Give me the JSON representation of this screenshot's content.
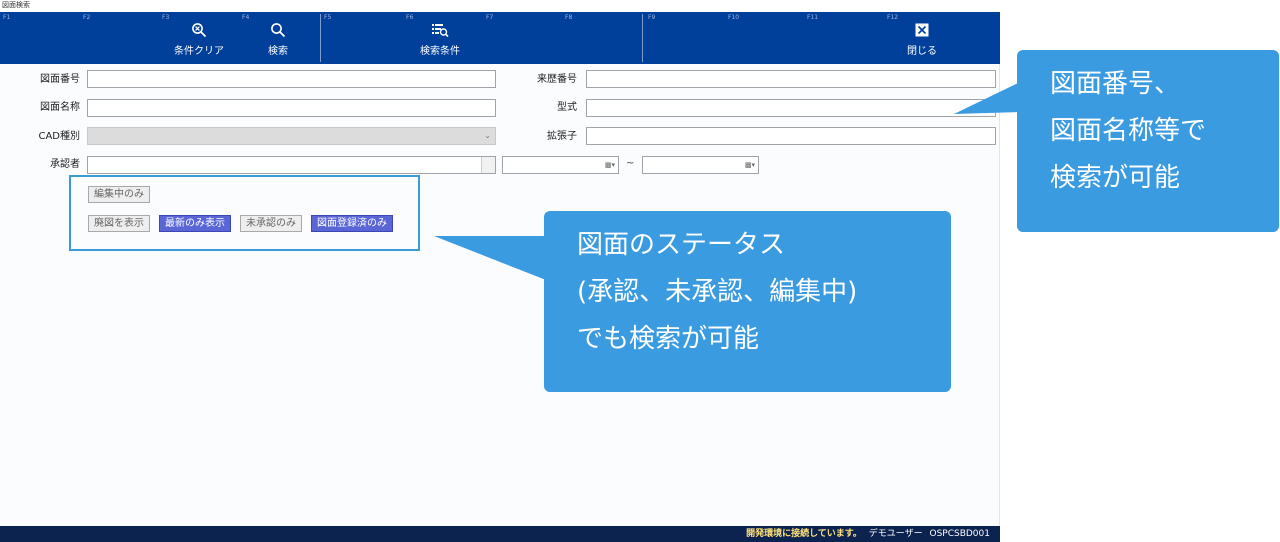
{
  "window": {
    "title": "図面検索"
  },
  "toolbar": {
    "fkeys": [
      "F1",
      "F2",
      "F3",
      "F4",
      "F5",
      "F6",
      "F7",
      "F8",
      "F9",
      "F10",
      "F11",
      "F12"
    ],
    "buttons": {
      "clear": {
        "label": "条件クリア",
        "icon": "zoom-reset-icon"
      },
      "search": {
        "label": "検索",
        "icon": "search-icon"
      },
      "conditions": {
        "label": "検索条件",
        "icon": "search-list-icon"
      },
      "close": {
        "label": "閉じる",
        "icon": "close-icon"
      }
    }
  },
  "form": {
    "drawing_number": {
      "label": "図面番号",
      "value": ""
    },
    "history_number": {
      "label": "来歴番号",
      "value": ""
    },
    "drawing_name": {
      "label": "図面名称",
      "value": ""
    },
    "model": {
      "label": "型式",
      "value": ""
    },
    "cad_type": {
      "label": "CAD種別",
      "value": ""
    },
    "extension": {
      "label": "拡張子",
      "value": ""
    },
    "approver": {
      "label": "承認者",
      "value": ""
    },
    "range_separator": "~"
  },
  "status_buttons": {
    "editing": {
      "label": "編集中のみ",
      "active": false
    },
    "show_obsolete": {
      "label": "廃図を表示",
      "active": false
    },
    "latest_only": {
      "label": "最新のみ表示",
      "active": true
    },
    "unapproved_only": {
      "label": "未承認のみ",
      "active": false
    },
    "registered_only": {
      "label": "図面登録済のみ",
      "active": true
    }
  },
  "footer": {
    "message": "開発環境に接続しています。",
    "user": "デモユーザー",
    "code": "OSPCSBD001"
  },
  "callouts": {
    "top": {
      "lines": [
        "図面番号、",
        "図面名称等で",
        "検索が可能"
      ]
    },
    "status": {
      "lines": [
        "図面のステータス",
        "(承認、未承認、編集中)",
        "でも検索が可能"
      ]
    }
  },
  "colors": {
    "toolbar": "#003f9a",
    "callout": "#3a9be0",
    "active_button": "#5a66d6",
    "footer": "#0c2350"
  }
}
